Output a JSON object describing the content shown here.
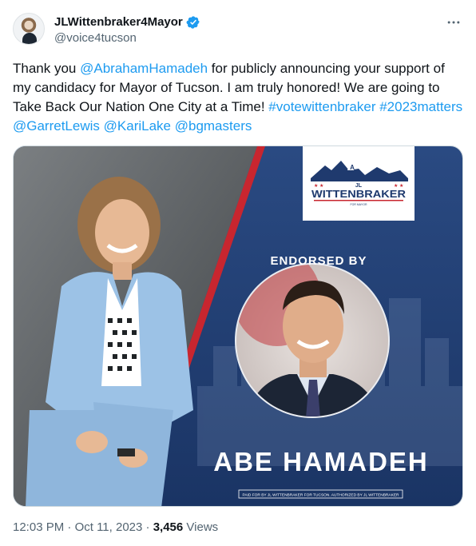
{
  "author": {
    "display_name": "JLWittenbraker4Mayor",
    "handle": "@voice4tucson",
    "verified_color": "#1d9bf0"
  },
  "more_icon": "more-horizontal-icon",
  "tweet": {
    "text_1": "Thank you ",
    "mention_1": "@AbrahamHamadeh",
    "text_2": " for publicly announcing your support of my candidacy for Mayor of Tucson. I am truly honored! We are going to Take Back Our Nation One City at a Time! ",
    "hashtag_1": "#votewittenbraker",
    "hashtag_2": "#2023matters",
    "mention_2": "@GarretLewis",
    "mention_3": "@KariLake",
    "mention_4": "@bgmasters"
  },
  "graphic": {
    "logo_name": "WITTENBRAKER",
    "logo_initials": "JL",
    "logo_letter": "A",
    "logo_sub": "FOR MAYOR",
    "endorsed_by": "ENDORSED BY",
    "endorser": "ABE HAMADEH",
    "disclaimer": "PAID FOR BY JL WITTENBRAKER FOR TUCSON. AUTHORIZED BY JL WITTENBRAKER",
    "colors": {
      "navy": "#1f3a6e",
      "red": "#c8262f",
      "suit": "#9cc2e6",
      "gray_bg": "#5a5e61"
    }
  },
  "meta": {
    "time": "12:03 PM",
    "date": "Oct 11, 2023",
    "separator": "·",
    "views_count": "3,456",
    "views_label": "Views"
  }
}
